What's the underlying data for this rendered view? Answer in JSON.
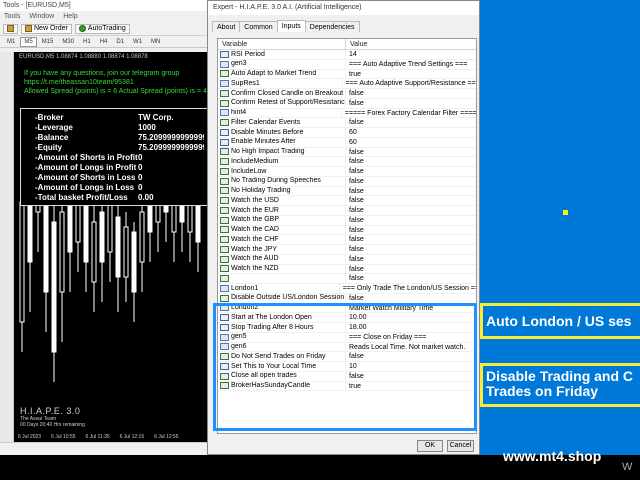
{
  "mt4": {
    "title": "Tools - [EURUSD,M5]",
    "menu": [
      "Tools",
      "Window",
      "Help"
    ],
    "toolbar": {
      "new_order": "New Order",
      "autotrading": "AutoTrading"
    },
    "timeframes": [
      "M1",
      "M5",
      "M15",
      "M30",
      "H1",
      "H4",
      "D1",
      "W1",
      "MN"
    ],
    "chart_header": "EURUSD,M5  1.08874 1.08880 1.08874 1.08878",
    "telegram": [
      "If you have any questions, join our telegram group",
      "https://t.me/theassan10team/95381",
      "Allowed Spread (points) is = 6 Actual Spread (points) is = 4"
    ],
    "info_rows": [
      {
        "label": "-Broker",
        "value": "TW Corp."
      },
      {
        "label": "-Leverage",
        "value": "1000"
      },
      {
        "label": "-Balance",
        "value": "75.20999999999999"
      },
      {
        "label": "-Equity",
        "value": "75.20999999999999"
      },
      {
        "label": "-Amount of Shorts in Profit",
        "value": "0"
      },
      {
        "label": "-Amount of Longs in Profit",
        "value": "0"
      },
      {
        "label": "-Amount of Shorts in Loss",
        "value": "0"
      },
      {
        "label": "-Amount of Longs in Loss",
        "value": "0"
      },
      {
        "label": "-Total basket Profit/Loss",
        "value": "0.00"
      }
    ],
    "brand_name": "H.I.A.P.E. 3.0",
    "brand_team": "The Assar Team",
    "brand_remaining": "00 Days 20:40 Hrs remaining",
    "x_axis": [
      "6 Jul 2023",
      "6 Jul 10:55",
      "6 Jul 11:35",
      "6 Jul 12:15",
      "6 Jul 12:55"
    ]
  },
  "dialog": {
    "title": "Expert - H.I.A.P.E. 3.0 A.I. (Artificial Intelligence)",
    "tabs": [
      "About",
      "Common",
      "Inputs",
      "Dependencies"
    ],
    "col_variable": "Variable",
    "col_value": "Value",
    "rows": [
      {
        "icon": "num",
        "var": "RSI Period",
        "val": "14"
      },
      {
        "icon": "ab",
        "var": "gen3",
        "val": "=== Auto Adaptive Trend Settings ==="
      },
      {
        "icon": "val",
        "var": "Auto Adapt to Market Trend",
        "val": "true"
      },
      {
        "icon": "ab",
        "var": "SupRes1",
        "val": "=== Auto Adaptive Support/Resistance ==="
      },
      {
        "icon": "val",
        "var": "Confirm Closed Candle on Breakout",
        "val": "false"
      },
      {
        "icon": "val",
        "var": "Confirm Retest of Support/Resistance",
        "val": "false"
      },
      {
        "icon": "ab",
        "var": "hint4",
        "val": "===== Forex Factory Calendar Filter ====="
      },
      {
        "icon": "val",
        "var": "Filter Calendar Events",
        "val": "false"
      },
      {
        "icon": "num",
        "var": "Disable Minutes Before",
        "val": "60"
      },
      {
        "icon": "num",
        "var": "Enable Minutes After",
        "val": "60"
      },
      {
        "icon": "val",
        "var": "No High Impact Trading",
        "val": "false"
      },
      {
        "icon": "val",
        "var": "IncludeMedium",
        "val": "false"
      },
      {
        "icon": "val",
        "var": "IncludeLow",
        "val": "false"
      },
      {
        "icon": "val",
        "var": "No Trading During Speeches",
        "val": "false"
      },
      {
        "icon": "val",
        "var": "No Holiday Trading",
        "val": "false"
      },
      {
        "icon": "val",
        "var": "Watch the USD",
        "val": "false"
      },
      {
        "icon": "val",
        "var": "Watch the EUR",
        "val": "false"
      },
      {
        "icon": "val",
        "var": "Watch the GBP",
        "val": "false"
      },
      {
        "icon": "val",
        "var": "Watch the CAD",
        "val": "false"
      },
      {
        "icon": "val",
        "var": "Watch the CHF",
        "val": "false"
      },
      {
        "icon": "val",
        "var": "Watch the JPY",
        "val": "false"
      },
      {
        "icon": "val",
        "var": "Watch the AUD",
        "val": "false"
      },
      {
        "icon": "val",
        "var": "Watch the NZD",
        "val": "false"
      },
      {
        "icon": "val",
        "var": "",
        "val": "false"
      },
      {
        "icon": "ab",
        "var": "London1",
        "val": "=== Only Trade The London/US Session ==="
      },
      {
        "icon": "val",
        "var": "Disable Outside US/London Session",
        "val": "false"
      },
      {
        "icon": "ab",
        "var": "London2",
        "val": "Market Watch Military Time"
      },
      {
        "icon": "num",
        "var": "Start at The London Open",
        "val": "10.00"
      },
      {
        "icon": "num",
        "var": "Stop Trading After 8 Hours",
        "val": "18.00"
      },
      {
        "icon": "ab",
        "var": "gen5",
        "val": "=== Close on Friday ==="
      },
      {
        "icon": "ab",
        "var": "gen6",
        "val": "Reads Local Time. Not market watch."
      },
      {
        "icon": "val",
        "var": "Do Not Send Trades on Friday",
        "val": "false"
      },
      {
        "icon": "num",
        "var": "Set This to Your Local Time",
        "val": "10"
      },
      {
        "icon": "val",
        "var": "Close all open trades",
        "val": "false"
      },
      {
        "icon": "val",
        "var": "BrokerHasSundayCandle",
        "val": "true"
      }
    ],
    "ok": "OK",
    "cancel": "Cancel"
  },
  "callouts": {
    "c1": "Auto London / US ses",
    "c2_l1": "Disable Trading and C",
    "c2_l2": "Trades on Friday"
  },
  "website": "www.mt4.shop",
  "watermark": "W"
}
